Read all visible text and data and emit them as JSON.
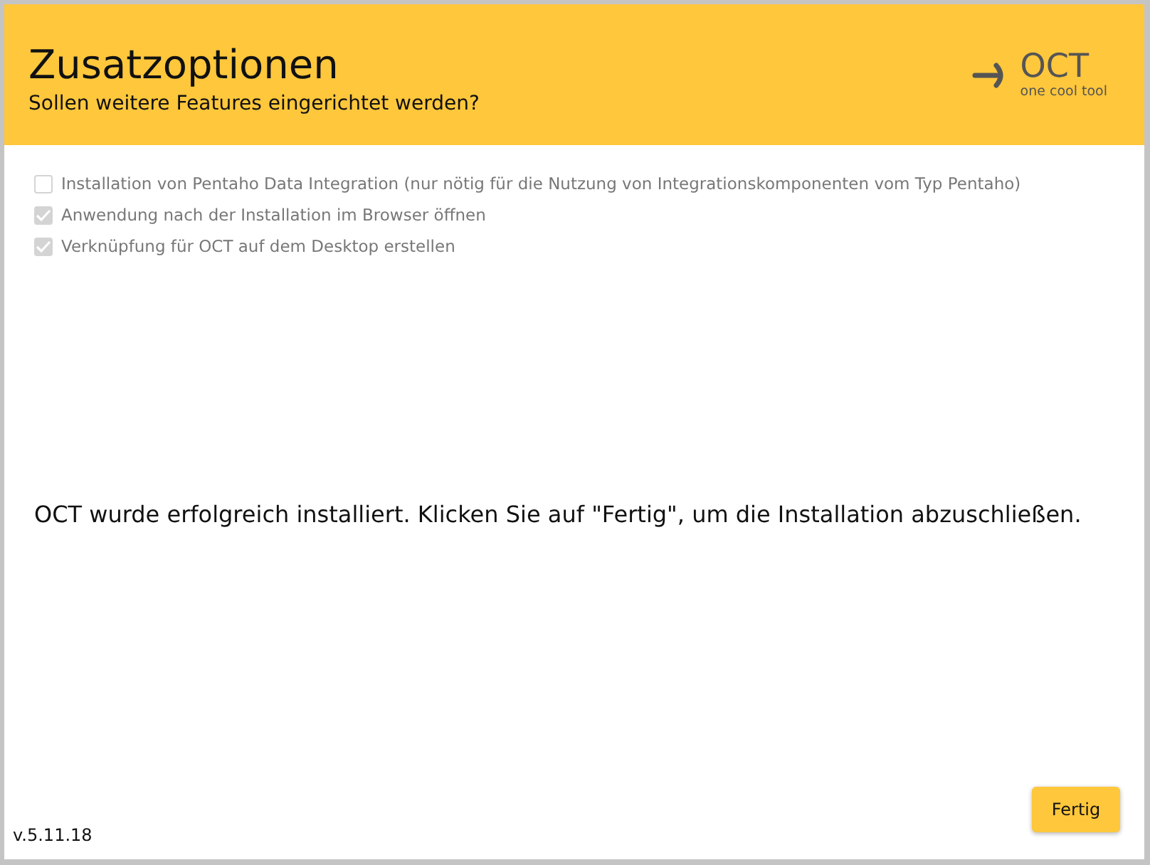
{
  "header": {
    "title": "Zusatzoptionen",
    "subtitle": "Sollen weitere Features eingerichtet werden?",
    "logo": {
      "name": "OCT",
      "tagline": "one cool tool"
    }
  },
  "options": [
    {
      "label": "Installation von Pentaho Data Integration (nur nötig für die Nutzung von Integrationskomponenten vom Typ Pentaho)",
      "checked": false,
      "disabled": true
    },
    {
      "label": "Anwendung nach der Installation im Browser öffnen",
      "checked": true,
      "disabled": true
    },
    {
      "label": "Verknüpfung für OCT auf dem Desktop erstellen",
      "checked": true,
      "disabled": true
    }
  ],
  "message": "OCT wurde erfolgreich installiert. Klicken Sie auf \"Fertig\", um die Installation abzuschließen.",
  "footer": {
    "version": "v.5.11.18",
    "buttons": [
      "Fertig"
    ]
  }
}
